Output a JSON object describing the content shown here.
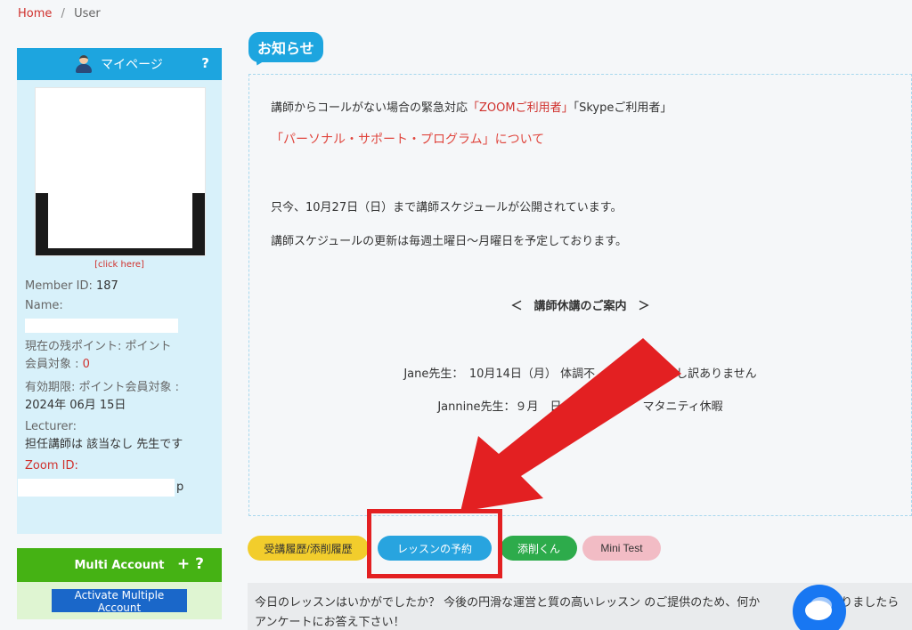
{
  "breadcrumb": {
    "home": "Home",
    "separator": "/",
    "current": "User"
  },
  "sidebar": {
    "mypage": {
      "title": "マイページ",
      "help": "?",
      "photo_link": "[click here]",
      "member_id_label": "Member ID:",
      "member_id_value": "187",
      "name_label": "Name:",
      "points_label": "現在の残ポイント: ポイント",
      "member_target_label": "会員対象 :",
      "member_target_value": "0",
      "expiry_label": "有効期限: ポイント会員対象 :",
      "expiry_value": "2024年 06月 15日",
      "lecturer_label": "Lecturer:",
      "lecturer_value": "担任講師は 該当なし 先生です",
      "zoom_label": "Zoom ID:",
      "zoom_tail": "p"
    },
    "multi_account": {
      "title": "Multi Account",
      "plus": "+",
      "help": "?",
      "activate_label": "Activate Multiple Account"
    }
  },
  "notice": {
    "title": "お知らせ",
    "line1_prefix": "講師からコールがない場合の緊急対応",
    "line1_zoom": "「ZOOMご利用者」",
    "line1_skype": "「Skypeご利用者」",
    "personal_support": "「パーソナル・サポート・プログラム」について",
    "schedule_line": "只今、10月27日（日）まで講師スケジュールが公開されています。",
    "update_line": "講師スケジュールの更新は毎週土曜日～月曜日を予定しております。",
    "holiday_heading": "＜　講師休講のご案内　＞",
    "jane_line": "Jane先生：　10月14日（月） 体調不　　　　　　　し訳ありません",
    "jannine_line": "Jannine先生：９月　日～　　　　　　マタニティ休暇"
  },
  "tabs": [
    {
      "label": "受講履歴/添削履歴"
    },
    {
      "label": "レッスンの予約"
    },
    {
      "label": "添削くん"
    },
    {
      "label": "Mini Test"
    }
  ],
  "survey": {
    "text": "今日のレッスンはいかがでしたか？ 今後の円滑な運営と質の高いレッスン のご提供のため、何か　　　　点がありましたら アンケートにお答え下さい！"
  },
  "colors": {
    "accent_blue": "#1da5df",
    "accent_red": "#e32022",
    "multi_green": "#45b214",
    "chat_blue": "#1877f2"
  },
  "icons": [
    "user-avatar-icon",
    "help-icon",
    "plus-icon",
    "chat-icon",
    "red-arrow-annotation"
  ]
}
